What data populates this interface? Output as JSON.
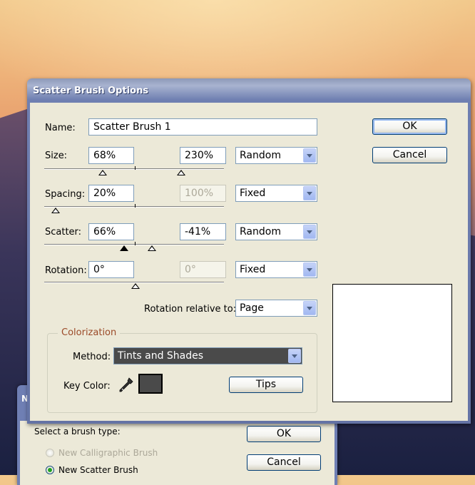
{
  "main_dialog": {
    "title": "Scatter Brush Options",
    "name": {
      "label": "Name:",
      "value": "Scatter Brush 1"
    },
    "size": {
      "label": "Size:",
      "min": "68%",
      "max": "230%",
      "variation": "Random"
    },
    "spacing": {
      "label": "Spacing:",
      "min": "20%",
      "max": "100%",
      "variation": "Fixed"
    },
    "scatter": {
      "label": "Scatter:",
      "min": "66%",
      "max": "-41%",
      "variation": "Random"
    },
    "rotation": {
      "label": "Rotation:",
      "min": "0°",
      "max": "0°",
      "variation": "Fixed"
    },
    "rotation_relative": {
      "label": "Rotation relative to:",
      "value": "Page"
    },
    "colorization": {
      "group_title": "Colorization",
      "method_label": "Method:",
      "method_value": "Tints and Shades",
      "key_color_label": "Key Color:",
      "key_color_hex": "#4a4a4a",
      "tips_label": "Tips"
    },
    "ok_label": "OK",
    "cancel_label": "Cancel"
  },
  "back_dialog": {
    "title": "N",
    "prompt": "Select a brush type:",
    "options": [
      "New Calligraphic Brush",
      "New Scatter Brush"
    ],
    "ok_label": "OK",
    "cancel_label": "Cancel"
  }
}
